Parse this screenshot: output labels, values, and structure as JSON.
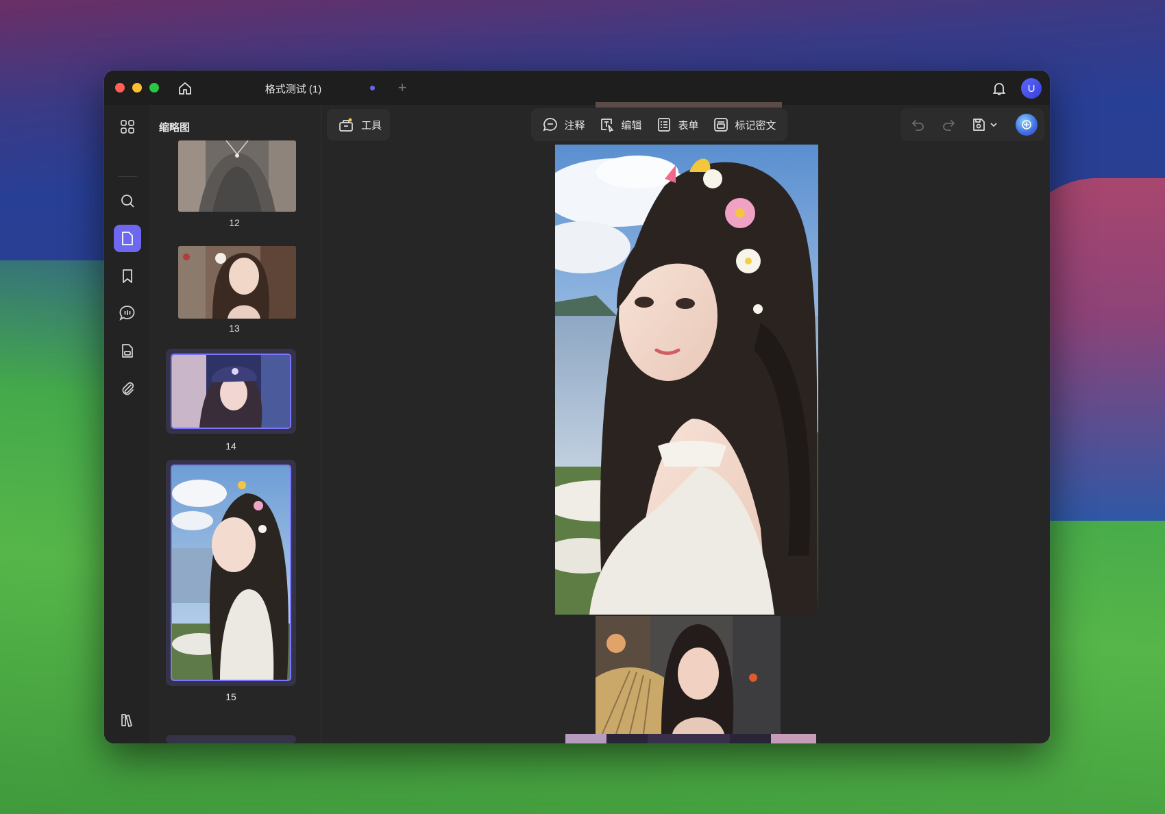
{
  "window": {
    "tab_title": "格式测试 (1)",
    "tab_add": "+",
    "avatar_initial": "U"
  },
  "rail": {
    "items": [
      "thumbnails-grid",
      "search",
      "pages",
      "bookmarks",
      "comments",
      "forms",
      "attachments"
    ],
    "active": "pages",
    "bottom": "library"
  },
  "thumbnails": {
    "title": "缩略图",
    "pages": [
      {
        "num": "12",
        "selected": false
      },
      {
        "num": "13",
        "selected": false
      },
      {
        "num": "14",
        "selected": true
      },
      {
        "num": "15",
        "selected": true
      }
    ]
  },
  "toolbar": {
    "tools_label": "工具",
    "comment_label": "注释",
    "edit_label": "编辑",
    "form_label": "表单",
    "redact_label": "标记密文"
  },
  "colors": {
    "accent": "#6e67f0",
    "window_bg": "#242424",
    "titlebar_bg": "#1e1e1e"
  }
}
